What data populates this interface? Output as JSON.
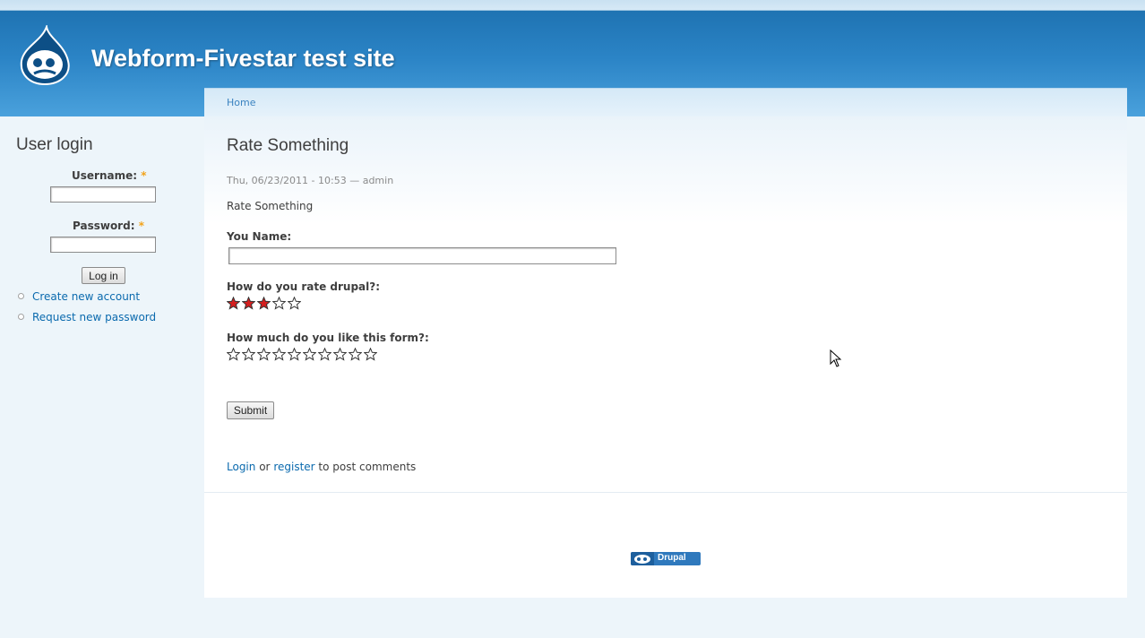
{
  "site": {
    "name": "Webform-Fivestar test site"
  },
  "breadcrumb": {
    "home": "Home"
  },
  "sidebar": {
    "title": "User login",
    "username_label": "Username:",
    "password_label": "Password:",
    "required_mark": "*",
    "username_value": "",
    "password_value": "",
    "login_button": "Log in",
    "links": [
      {
        "label": "Create new account"
      },
      {
        "label": "Request new password"
      }
    ]
  },
  "main": {
    "title": "Rate Something",
    "meta": "Thu, 06/23/2011 - 10:53 — admin",
    "body": "Rate Something",
    "name_label": "You Name:",
    "name_value": "",
    "rating1": {
      "label": "How do you rate drupal?:",
      "total_stars": 5,
      "filled_stars": 3
    },
    "rating2": {
      "label": "How much do you like this form?:",
      "total_stars": 10,
      "filled_stars": 0
    },
    "submit_button": "Submit",
    "comment_links": {
      "login": "Login",
      "or": "or",
      "register": "register",
      "suffix": "to post comments"
    }
  },
  "footer": {
    "badge_text": "Drupal"
  },
  "colors": {
    "star_filled": "#d41f1f",
    "link": "#0b6aae",
    "header": "#2b84c6"
  }
}
